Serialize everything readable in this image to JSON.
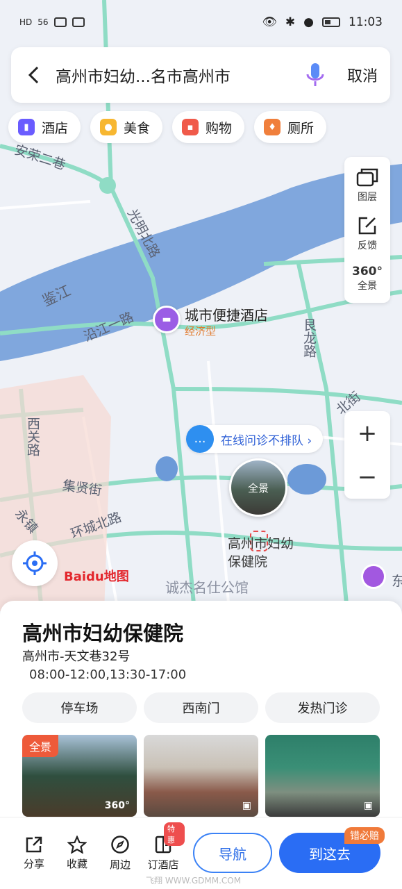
{
  "status": {
    "left_icons": [
      "HD",
      "56"
    ],
    "time": "11:03"
  },
  "search": {
    "query": "高州市妇幼...名市高州市",
    "cancel_label": "取消"
  },
  "categories": [
    {
      "label": "酒店",
      "icon": "hotel-icon",
      "color": "#6a5cff"
    },
    {
      "label": "美食",
      "icon": "food-icon",
      "color": "#f7b731"
    },
    {
      "label": "购物",
      "icon": "shopping-icon",
      "color": "#f05a4a"
    },
    {
      "label": "厕所",
      "icon": "toilet-icon",
      "color": "#f07f3c"
    }
  ],
  "map_tools": {
    "layers_label": "图层",
    "feedback_label": "反馈",
    "pano_label": "全景",
    "pano_num": "360°"
  },
  "zoom": {
    "in": "+",
    "out": "−"
  },
  "map_labels": {
    "road_1": "安荣二巷",
    "river": "鉴江",
    "road_2": "光明北路",
    "road_3": "沿江一路",
    "road_4": "艮龙路",
    "road_5": "北街",
    "road_6": "西关路",
    "road_7": "集贤街",
    "road_8": "环城北路",
    "road_9": "永镇",
    "area_1": "诚杰名仕公馆",
    "east_label": "东"
  },
  "hotel": {
    "name": "城市便捷酒店",
    "type": "经济型"
  },
  "consult": {
    "label": "在线问诊不排队 ›"
  },
  "pano_bubble": {
    "label": "全景"
  },
  "poi": {
    "name": "高州市妇幼保健院"
  },
  "baidu": {
    "brand": "Baidu地图"
  },
  "place": {
    "title": "高州市妇幼保健院",
    "address": "高州市-天文巷32号",
    "hours": "08:00-12:00,13:30-17:00",
    "chips": [
      "停车场",
      "西南门",
      "发热门诊"
    ],
    "photos": [
      {
        "tag": "全景",
        "badge": "360°"
      },
      {
        "tag": "",
        "badge": ""
      },
      {
        "tag": "",
        "badge": ""
      }
    ]
  },
  "bottom": {
    "items": [
      {
        "label": "分享",
        "icon": "share-icon"
      },
      {
        "label": "收藏",
        "icon": "star-icon"
      },
      {
        "label": "周边",
        "icon": "compass-icon"
      },
      {
        "label": "订酒店",
        "icon": "hotel-book-icon",
        "hot": "特惠"
      }
    ],
    "nav_label": "导航",
    "go_label": "到这去",
    "go_badge": "错必赔"
  },
  "watermark": "飞翔 WWW.GDMM.COM"
}
